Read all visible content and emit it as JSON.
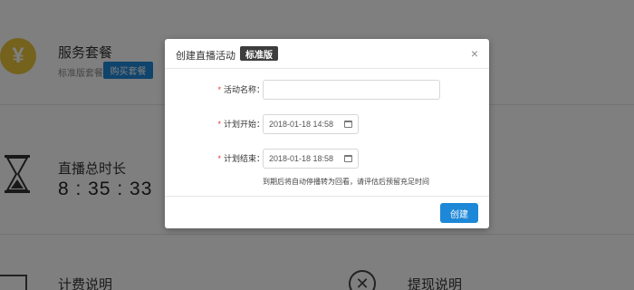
{
  "background": {
    "service": {
      "icon": "yen-icon",
      "title": "服务套餐",
      "subtitle": "标准版套餐",
      "buy_label": "购买套餐"
    },
    "duration": {
      "icon": "hourglass-icon",
      "title": "直播总时长",
      "value": "8 : 35 : 33"
    },
    "billing": {
      "icon": "document-icon",
      "title": "计费说明"
    },
    "withdraw": {
      "icon": "x-circle-icon",
      "title": "提现说明"
    }
  },
  "modal": {
    "title": "创建直播活动",
    "badge": "标准版",
    "close_glyph": "×",
    "fields": {
      "name": {
        "label": "活动名称：",
        "value": ""
      },
      "start": {
        "label": "计划开始：",
        "value": "2018-01-18 14:58"
      },
      "end": {
        "label": "计划结束：",
        "value": "2018-01-18 18:58"
      }
    },
    "required_mark": "*",
    "hint": "到期后将自动停播转为回看，请评估后预留充足时间",
    "create_label": "创建"
  },
  "colors": {
    "accent": "#1e88d8",
    "badge_bg": "#3d3d3d",
    "yen_gold": "#e9c43a",
    "required": "#e33333"
  }
}
